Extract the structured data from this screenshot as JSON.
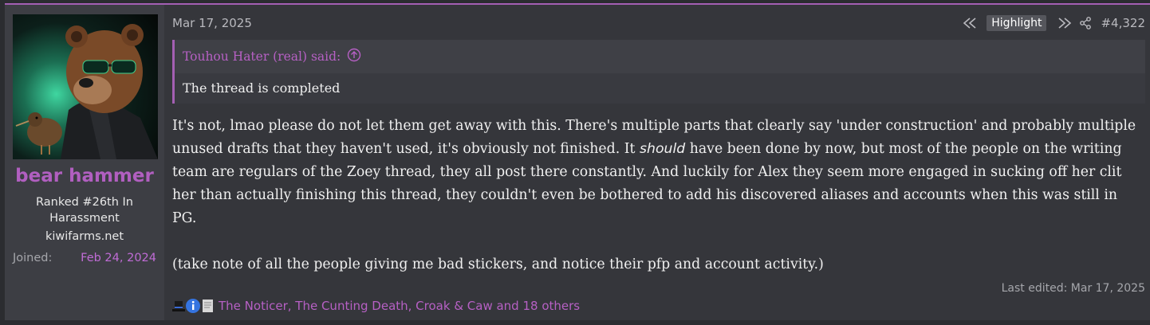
{
  "post": {
    "date": "Mar 17, 2025",
    "post_number": "#4,322",
    "highlight_label": "Highlight"
  },
  "user": {
    "name": "bear hammer",
    "title": "Ranked #26th In Harassment",
    "site": "kiwifarms.net",
    "joined_label": "Joined:",
    "joined_value": "Feb 24, 2024"
  },
  "quote": {
    "author": "Touhou Hater (real) said:",
    "text": "The thread is completed"
  },
  "message": {
    "p1_before": "It's not, lmao please do not let them get away with this. There's multiple parts that clearly say 'under construction' and probably multiple unused drafts that they haven't used, it's obviously not finished. It ",
    "p1_emph": "should",
    "p1_after": " have been done by now, but most of the people on the writing team are regulars of the Zoey thread, they all post there constantly. And luckily for Alex they seem more engaged in sucking off her clit her than actually finishing this thread, they couldn't even be bothered to add his discovered aliases and accounts when this was still in PG.",
    "p2": "(take note of all the people giving me bad stickers, and notice their pfp and account activity.)"
  },
  "edited": "Last edited: Mar 17, 2025",
  "reactions": {
    "icons": [
      "top-hat-icon",
      "informative-icon",
      "paper-icon"
    ],
    "list": "The Noticer, The Cunting Death, Croak & Caw and 18 others"
  },
  "colors": {
    "accent": "#a45fb3",
    "username": "#b15fc0",
    "link": "#b660c4"
  }
}
